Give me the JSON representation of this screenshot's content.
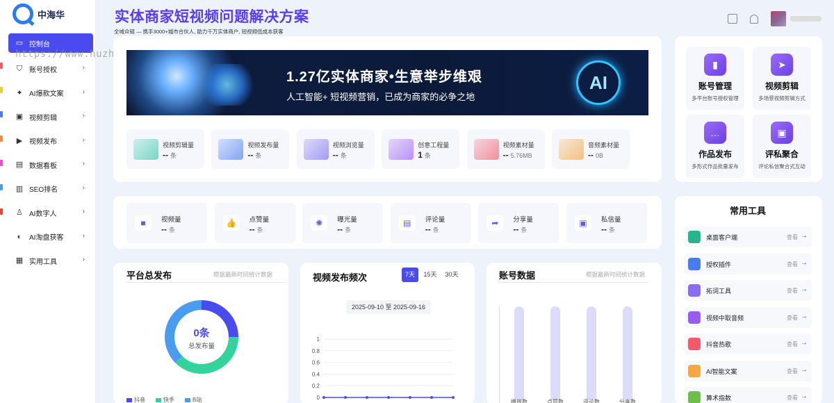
{
  "app": {
    "name": "中海华"
  },
  "watermark": "https://www.huzhan.com/ishop52894",
  "sidebar": {
    "items": [
      {
        "label": "控制台",
        "icon": "monitor-icon",
        "active": true
      },
      {
        "label": "账号授权",
        "icon": "shield-icon"
      },
      {
        "label": "AI爆款文案",
        "icon": "bulb-icon"
      },
      {
        "label": "视频剪辑",
        "icon": "film-icon"
      },
      {
        "label": "视频发布",
        "icon": "play-icon"
      },
      {
        "label": "数据看板",
        "icon": "chart-icon"
      },
      {
        "label": "SEO排名",
        "icon": "bars-icon"
      },
      {
        "label": "AI数字人",
        "icon": "user-icon"
      },
      {
        "label": "AI淘盘获客",
        "icon": "headset-icon"
      },
      {
        "label": "实用工具",
        "icon": "toolbox-icon"
      }
    ]
  },
  "header": {
    "title": "实体商家短视频问题解决方案",
    "subtitle": "全域众链 — 携手3000+城市合伙人, 助力千万实体商户, 短视频低成本获客"
  },
  "banner": {
    "headline": "1.27亿实体商家•生意举步维艰",
    "subline": "人工智能+ 短视频营销，已成为商家的必争之地",
    "ai_badge": "AI"
  },
  "material_stats": [
    {
      "label": "视频剪辑量",
      "value": "--",
      "unit": "条",
      "color": "#38c8a8"
    },
    {
      "label": "视频发布量",
      "value": "--",
      "unit": "条",
      "color": "#4a7cf0"
    },
    {
      "label": "视频浏览量",
      "value": "--",
      "unit": "条",
      "color": "#7b6cf0"
    },
    {
      "label": "创意工程量",
      "value": "1",
      "unit": "条",
      "color": "#9a5cf0"
    },
    {
      "label": "视频素材量",
      "value": "--",
      "unit": "5.76MB",
      "color": "#f05a6a"
    },
    {
      "label": "音频素材量",
      "value": "--",
      "unit": "0B",
      "color": "#f5a742"
    }
  ],
  "engagement_stats": [
    {
      "label": "视频量",
      "value": "--",
      "unit": "条",
      "icon": "video-icon"
    },
    {
      "label": "点赞量",
      "value": "--",
      "unit": "条",
      "icon": "thumb-icon"
    },
    {
      "label": "曝光量",
      "value": "--",
      "unit": "条",
      "icon": "bulb-icon"
    },
    {
      "label": "评论量",
      "value": "--",
      "unit": "条",
      "icon": "comment-icon"
    },
    {
      "label": "分享量",
      "value": "--",
      "unit": "条",
      "icon": "share-icon"
    },
    {
      "label": "私信量",
      "value": "--",
      "unit": "条",
      "icon": "message-icon"
    }
  ],
  "quick_actions": [
    {
      "title": "账号管理",
      "desc": "多平台账号授权管理",
      "icon": "bag-icon"
    },
    {
      "title": "视频剪辑",
      "desc": "多场景视频剪辑方式",
      "icon": "send-icon"
    },
    {
      "title": "作品发布",
      "desc": "多形式作品批量发布",
      "icon": "chat-icon"
    },
    {
      "title": "评私聚合",
      "desc": "评论私信聚合式互动",
      "icon": "box-icon"
    }
  ],
  "tools": {
    "title": "常用工具",
    "view_label": "查看",
    "items": [
      {
        "name": "桌面客户端",
        "color": "#26b58c"
      },
      {
        "name": "授权插件",
        "color": "#4a7cf0"
      },
      {
        "name": "拓词工具",
        "color": "#8a6cf0"
      },
      {
        "name": "视频中取音频",
        "color": "#9a5cf0"
      },
      {
        "name": "抖音热歌",
        "color": "#f05a6a"
      },
      {
        "name": "AI智能文案",
        "color": "#f5a742"
      },
      {
        "name": "算术指数",
        "color": "#6cc04a"
      }
    ]
  },
  "platform_panel": {
    "title": "平台总发布",
    "note": "根据最新时间统计数据",
    "center_value": "0条",
    "center_label": "总发布量",
    "legend": [
      "抖音",
      "快手",
      "B站"
    ],
    "colors": [
      "#4a4bef",
      "#34d39b",
      "#4a9cf0"
    ]
  },
  "frequency_panel": {
    "title": "视频发布频次",
    "tabs": [
      "7天",
      "15天",
      "30天"
    ],
    "active_tab": "7天",
    "date_range": "2025-09-10 至 2025-09-16"
  },
  "account_panel": {
    "title": "账号数据",
    "note": "根据最新时间统计数据",
    "categories": [
      "播放数",
      "点赞数",
      "评论数",
      "分享数"
    ]
  },
  "chart_data": [
    {
      "type": "line",
      "title": "视频发布频次",
      "y_ticks": [
        0,
        0.2,
        0.4,
        0.6,
        0.8,
        1
      ],
      "ylim": [
        0,
        1
      ],
      "values": [
        0,
        0,
        0,
        0,
        0,
        0,
        0
      ],
      "grid": true
    }
  ]
}
